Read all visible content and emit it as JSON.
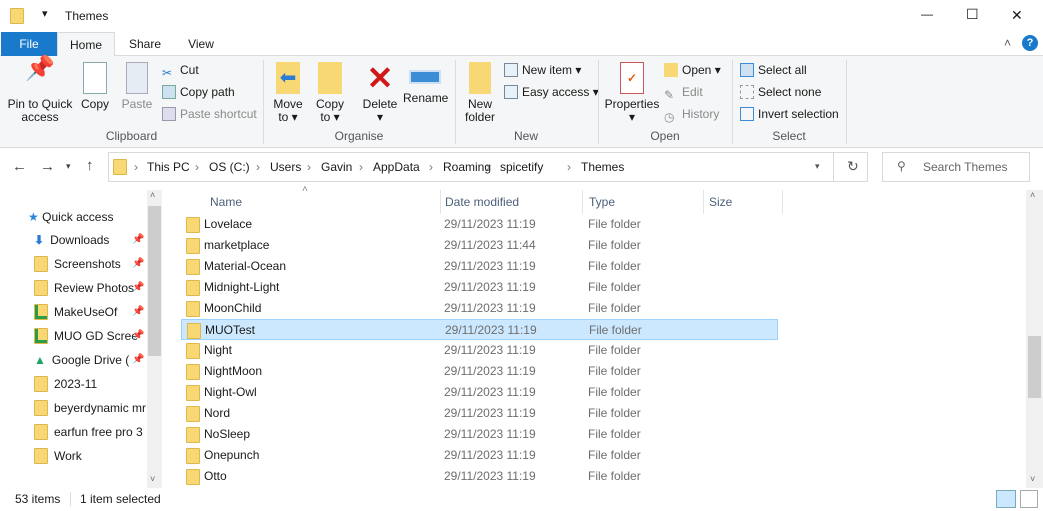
{
  "window": {
    "title": "Themes",
    "minimize": "—",
    "maximize": "☐",
    "close": "✕"
  },
  "ribbon_tabs": [
    {
      "label": "File"
    },
    {
      "label": "Home"
    },
    {
      "label": "Share"
    },
    {
      "label": "View"
    }
  ],
  "ribbon": {
    "clipboard": {
      "label": "Clipboard",
      "pin": "Pin to Quick access",
      "copy": "Copy",
      "paste": "Paste",
      "cut": "Cut",
      "copy_path": "Copy path",
      "paste_shortcut": "Paste shortcut"
    },
    "organise": {
      "label": "Organise",
      "move_to": "Move to",
      "copy_to": "Copy to",
      "delete": "Delete",
      "rename": "Rename"
    },
    "new": {
      "label": "New",
      "new_folder": "New folder",
      "new_item": "New item",
      "easy_access": "Easy access"
    },
    "open": {
      "label": "Open",
      "properties": "Properties",
      "open": "Open",
      "edit": "Edit",
      "history": "History"
    },
    "select": {
      "label": "Select",
      "select_all": "Select all",
      "select_none": "Select none",
      "invert": "Invert selection"
    }
  },
  "address": {
    "crumbs": [
      "This PC",
      "OS (C:)",
      "Users",
      "Gavin",
      "AppData",
      "Roaming",
      "spicetify",
      "Themes"
    ],
    "search_placeholder": "Search Themes"
  },
  "sidebar": {
    "items": [
      {
        "label": "Quick access",
        "icon": "star-icon"
      },
      {
        "label": "Downloads",
        "icon": "download-icon",
        "pinned": true
      },
      {
        "label": "Screenshots",
        "icon": "folder-icon",
        "pinned": true
      },
      {
        "label": "Review Photos",
        "icon": "folder-icon",
        "pinned": true
      },
      {
        "label": "MakeUseOf",
        "icon": "synced-folder-icon",
        "pinned": true
      },
      {
        "label": "MUO GD Scree",
        "icon": "synced-folder-icon",
        "pinned": true
      },
      {
        "label": "Google Drive (",
        "icon": "google-drive-icon",
        "pinned": true
      },
      {
        "label": "2023-11",
        "icon": "folder-icon"
      },
      {
        "label": "beyerdynamic mr",
        "icon": "folder-icon"
      },
      {
        "label": "earfun free pro 3",
        "icon": "folder-icon"
      },
      {
        "label": "Work",
        "icon": "folder-icon"
      }
    ]
  },
  "columns": [
    "Name",
    "Date modified",
    "Type",
    "Size"
  ],
  "files": [
    {
      "name": "Lovelace",
      "date": "29/11/2023 11:19",
      "type": "File folder"
    },
    {
      "name": "marketplace",
      "date": "29/11/2023 11:44",
      "type": "File folder"
    },
    {
      "name": "Material-Ocean",
      "date": "29/11/2023 11:19",
      "type": "File folder"
    },
    {
      "name": "Midnight-Light",
      "date": "29/11/2023 11:19",
      "type": "File folder"
    },
    {
      "name": "MoonChild",
      "date": "29/11/2023 11:19",
      "type": "File folder"
    },
    {
      "name": "MUOTest",
      "date": "29/11/2023 11:19",
      "type": "File folder",
      "selected": true
    },
    {
      "name": "Night",
      "date": "29/11/2023 11:19",
      "type": "File folder"
    },
    {
      "name": "NightMoon",
      "date": "29/11/2023 11:19",
      "type": "File folder"
    },
    {
      "name": "Night-Owl",
      "date": "29/11/2023 11:19",
      "type": "File folder"
    },
    {
      "name": "Nord",
      "date": "29/11/2023 11:19",
      "type": "File folder"
    },
    {
      "name": "NoSleep",
      "date": "29/11/2023 11:19",
      "type": "File folder"
    },
    {
      "name": "Onepunch",
      "date": "29/11/2023 11:19",
      "type": "File folder"
    },
    {
      "name": "Otto",
      "date": "29/11/2023 11:19",
      "type": "File folder"
    }
  ],
  "status": {
    "count": "53 items",
    "selected": "1 item selected"
  },
  "colors": {
    "accent": "#1979ca",
    "selection": "#cce8ff"
  }
}
